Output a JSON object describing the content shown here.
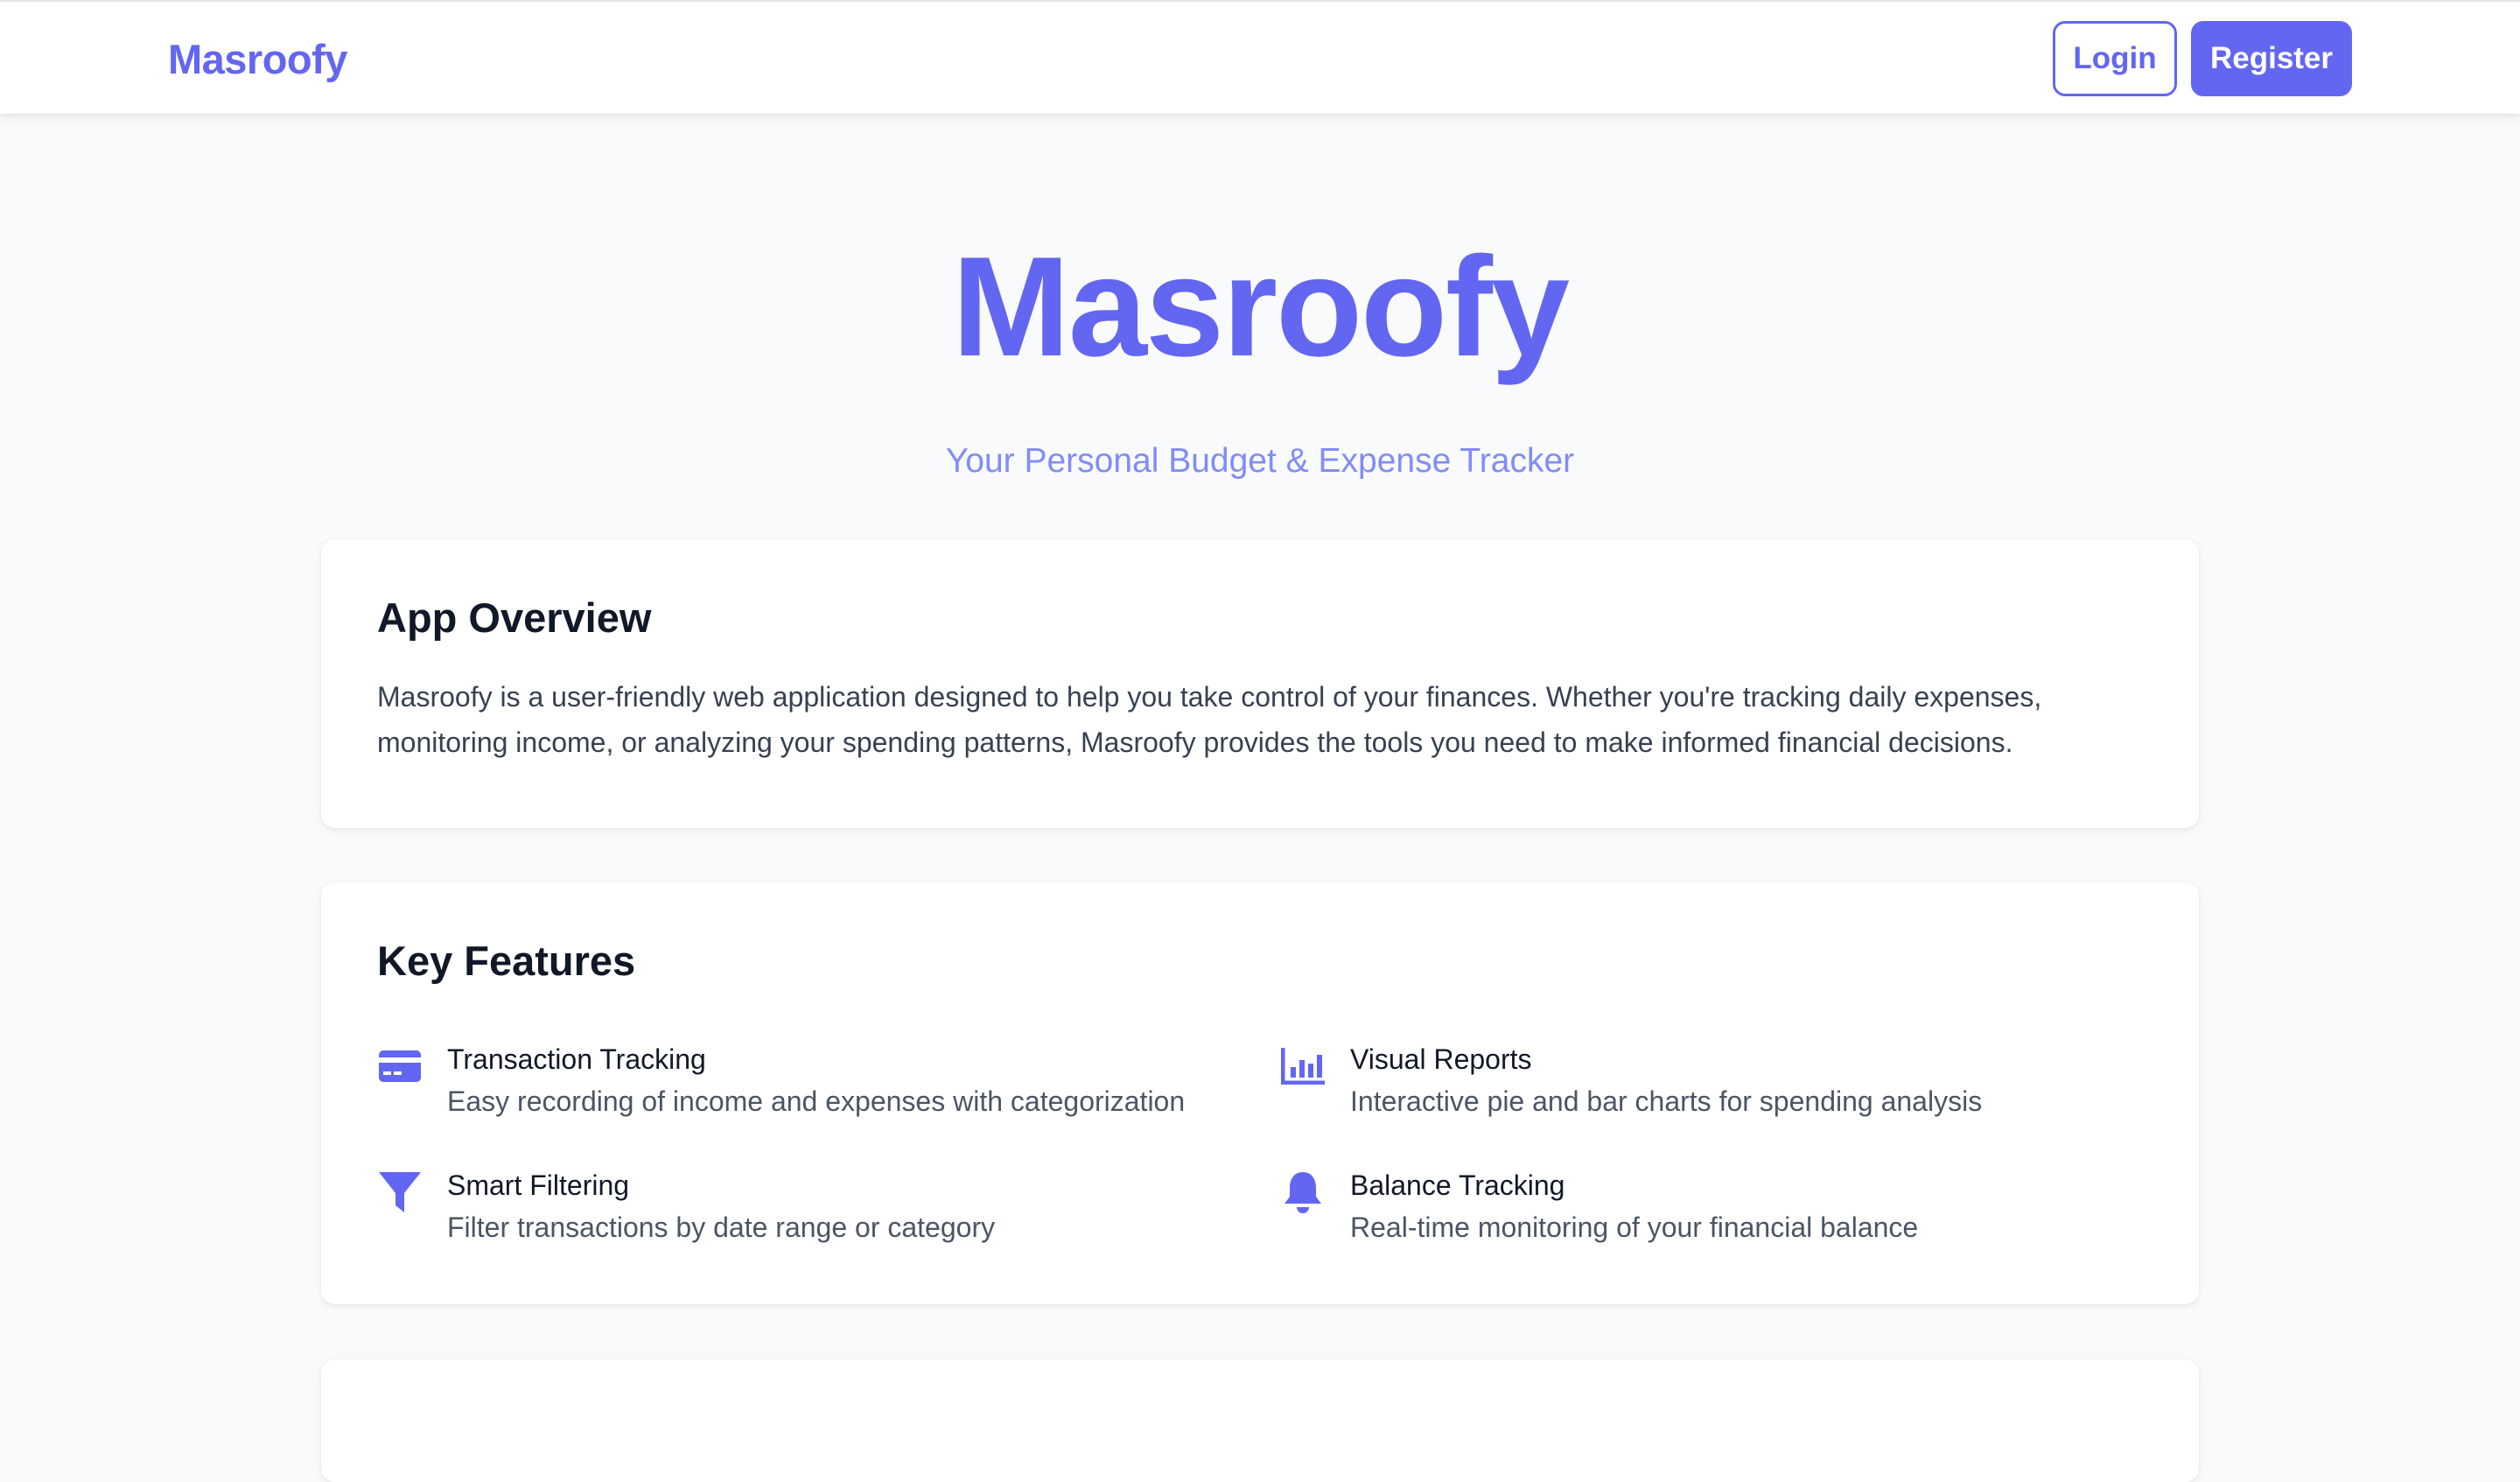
{
  "navbar": {
    "brand": "Masroofy",
    "login_label": "Login",
    "register_label": "Register"
  },
  "hero": {
    "title": "Masroofy",
    "subtitle": "Your Personal Budget & Expense Tracker"
  },
  "overview": {
    "title": "App Overview",
    "text": "Masroofy is a user-friendly web application designed to help you take control of your finances. Whether you're tracking daily expenses, monitoring income, or analyzing your spending patterns, Masroofy provides the tools you need to make informed financial decisions."
  },
  "features": {
    "title": "Key Features",
    "items": [
      {
        "icon": "credit-card-icon",
        "title": "Transaction Tracking",
        "description": "Easy recording of income and expenses with categorization"
      },
      {
        "icon": "bar-chart-icon",
        "title": "Visual Reports",
        "description": "Interactive pie and bar charts for spending analysis"
      },
      {
        "icon": "filter-icon",
        "title": "Smart Filtering",
        "description": "Filter transactions by date range or category"
      },
      {
        "icon": "bell-icon",
        "title": "Balance Tracking",
        "description": "Real-time monitoring of your financial balance"
      }
    ]
  },
  "colors": {
    "accent": "#6366f1",
    "subtitle": "#818cf8",
    "background": "#f9fafb",
    "card": "#ffffff",
    "heading": "#111827",
    "body_text": "#374151"
  }
}
